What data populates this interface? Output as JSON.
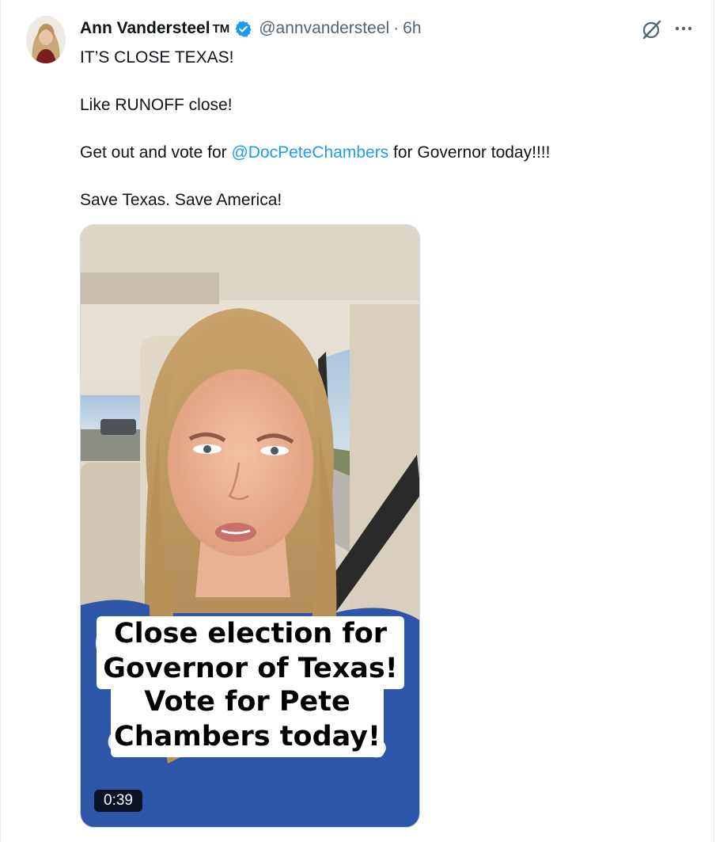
{
  "author": {
    "name": "Ann Vandersteel",
    "badge_text": "TM",
    "verified_icon": "verified-badge-icon",
    "handle": "@annvandersteel",
    "separator": "·",
    "time": "6h"
  },
  "actions": {
    "grok_icon": "grok-icon",
    "more_icon": "more-options-icon"
  },
  "post": {
    "line1": "IT’S CLOSE TEXAS!",
    "line2": "Like RUNOFF close!",
    "line3_before": "Get out and vote for ",
    "line3_mention": "@DocPeteChambers",
    "line3_after": " for Governor today!!!!",
    "line4": "Save Texas. Save America!"
  },
  "video": {
    "caption_lines": [
      "Close election for",
      "Governor of Texas!",
      "Vote for Pete",
      "Chambers today!"
    ],
    "duration": "0:39"
  },
  "colors": {
    "link": "#1d9bf0",
    "verified": "#1d9bf0",
    "secondary_text": "#536471",
    "primary_text": "#0f1419"
  }
}
